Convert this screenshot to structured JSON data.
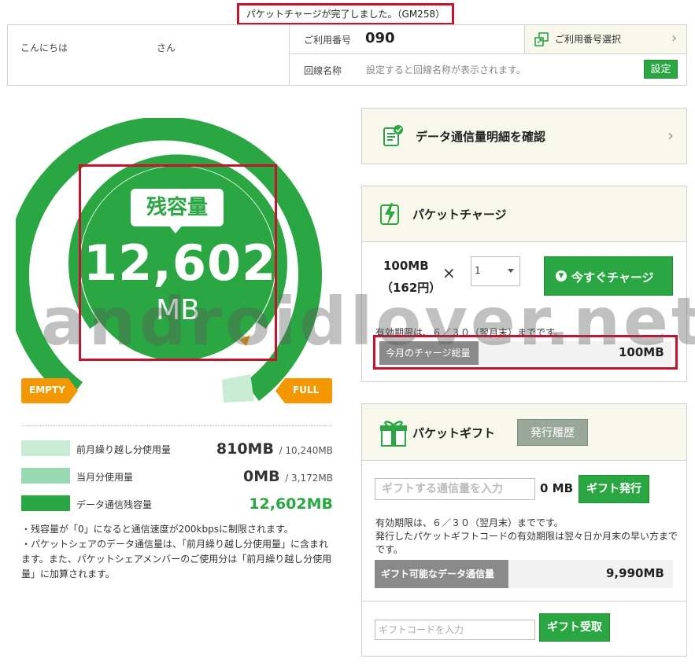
{
  "notice": "パケットチャージが完了しました。（GM258）",
  "header": {
    "greeting": "こんにちは",
    "greeting_suffix": "さん",
    "number_label": "ご利用番号",
    "number_value": "090",
    "select_label": "ご利用番号選択",
    "line_label": "回線名称",
    "line_placeholder": "設定すると回線名称が表示されます。",
    "set_button": "設定"
  },
  "gauge": {
    "title": "残容量",
    "value": "12,602",
    "unit": "MB",
    "empty_label": "EMPTY",
    "full_label": "FULL"
  },
  "legend": [
    {
      "label": "前月繰り越し分使用量",
      "value": "810MB",
      "total": "/ 10,240MB",
      "color": "#c9ead3"
    },
    {
      "label": "当月分使用量",
      "value": "0MB",
      "total": "/ 3,172MB",
      "color": "#97d9b0"
    },
    {
      "label": "データ通信残容量",
      "value": "12,602MB",
      "total": "",
      "color": "#2aa743"
    }
  ],
  "notes": [
    "・残容量が「0」になると通信速度が200kbpsに制限されます。",
    "・パケットシェアのデータ通信量は、「前月繰り越し分使用量」に含まれます。また、パケットシェアメンバーのご使用分は「前月繰り越し分使用量」に加算されます。"
  ],
  "detail_panel": {
    "label": "データ通信量明細を確認"
  },
  "charge_panel": {
    "title": "パケットチャージ",
    "plan_size": "100MB",
    "plan_price": "（162円）",
    "times": "×",
    "qty": "1",
    "charge_button": "今すぐチャージ",
    "expiry": "有効期限は、６／３０（翌月末）までです。",
    "total_label": "今月のチャージ総量",
    "total_value": "100MB"
  },
  "gift_panel": {
    "title": "パケットギフト",
    "history_button": "発行履歴",
    "amount_placeholder": "ギフトする通信量を入力",
    "amount_unit": "0 MB",
    "issue_button": "ギフト発行",
    "note1": "有効期限は、６／３０（翌月末）までです。",
    "note2": "発行したパケットギフトコードの有効期限は翌々日か月末の早い方までです。",
    "giftable_label": "ギフト可能なデータ通信量",
    "giftable_value": "9,990MB",
    "code_placeholder": "ギフトコードを入力",
    "receive_button": "ギフト受取"
  },
  "watermark": "androidlover.net",
  "colors": {
    "accent": "#2aa743",
    "highlight": "#c8102e",
    "orange": "#f39800"
  }
}
